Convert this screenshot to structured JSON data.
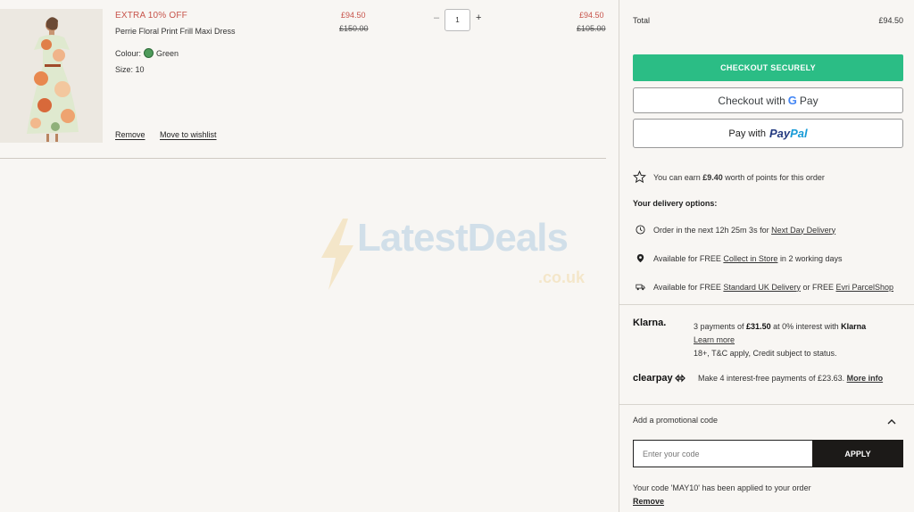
{
  "product": {
    "promo_badge": "EXTRA 10% OFF",
    "name": "Perrie Floral Print Frill Maxi Dress",
    "colour_label": "Colour:",
    "colour_value": "Green",
    "colour_swatch": "#4e9a5a",
    "size_text": "Size: 10",
    "unit_price": "£94.50",
    "unit_was": "£150.00",
    "quantity": "1",
    "qty_minus": "–",
    "qty_plus": "+",
    "line_price": "£94.50",
    "line_was": "£105.00",
    "remove_label": "Remove",
    "wishlist_label": "Move to wishlist"
  },
  "watermark": {
    "text": "LatestDeals",
    "sub": ".co.uk"
  },
  "summary": {
    "total_label": "Total",
    "total_value": "£94.50",
    "checkout_label": "CHECKOUT SECURELY",
    "gpay_prefix": "Checkout with",
    "gpay_g": "G",
    "gpay_pay": "Pay",
    "paypal_prefix": "Pay with",
    "paypal_pay": "Pay",
    "paypal_pal": "Pal",
    "points_prefix": "You can earn",
    "points_value": "£9.40",
    "points_suffix": "worth of points for this order",
    "delivery_title": "Your delivery options:",
    "delivery_1_prefix": "Order in the next 12h 25m 3s for",
    "delivery_1_link": "Next Day Delivery",
    "delivery_2_prefix": "Available for FREE",
    "delivery_2_link": "Collect in Store",
    "delivery_2_suffix": "in 2 working days",
    "delivery_3_prefix": "Available for FREE",
    "delivery_3_link1": "Standard UK Delivery",
    "delivery_3_mid": "or FREE",
    "delivery_3_link2": "Evri ParcelShop",
    "klarna_logo": "Klarna.",
    "klarna_prefix": "3 payments of",
    "klarna_amount": "£31.50",
    "klarna_mid": "at 0% interest with",
    "klarna_brand": "Klarna",
    "klarna_learn": "Learn more",
    "klarna_terms": "18+, T&C apply, Credit subject to status.",
    "clearpay_logo": "clearpay",
    "clearpay_text": "Make 4 interest-free payments of £23.63.",
    "clearpay_more": "More info",
    "promo_header": "Add a promotional code",
    "promo_placeholder": "Enter your code",
    "promo_apply": "APPLY",
    "promo_applied_text": "Your code 'MAY10' has been applied to your order",
    "promo_remove": "Remove"
  },
  "colors": {
    "accent_green": "#2bbd85",
    "sale_red": "#c7544b",
    "dark_button": "#1c1a18",
    "paypal_dark": "#253b80",
    "paypal_light": "#179bd7"
  }
}
